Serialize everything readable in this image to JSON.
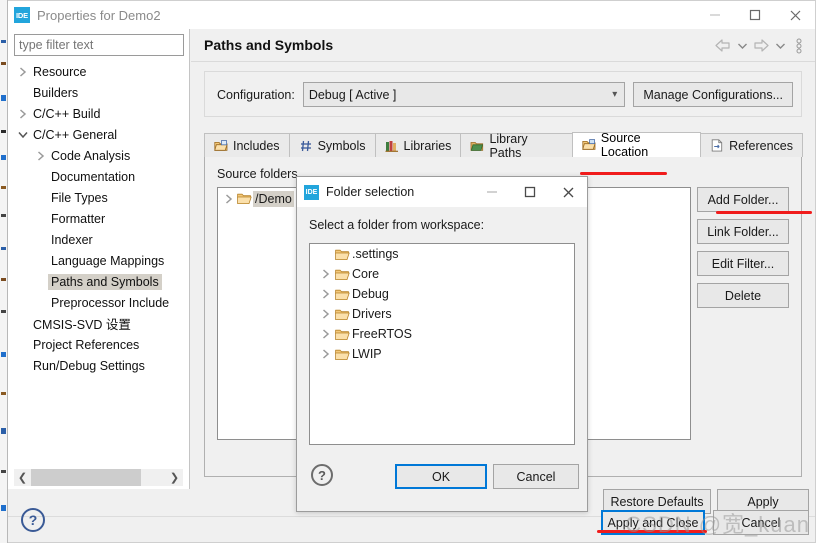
{
  "window": {
    "title": "Properties for Demo2",
    "icon": "IDE",
    "controls": {
      "minimize": "minimize-icon",
      "maximize": "maximize-icon",
      "close": "close-icon"
    }
  },
  "sidebar": {
    "filter_placeholder": "type filter text",
    "filter_value": "",
    "items": [
      {
        "label": "Resource",
        "indent": 0,
        "arrow": "collapsed",
        "selected": false
      },
      {
        "label": "Builders",
        "indent": 0,
        "arrow": "none",
        "selected": false
      },
      {
        "label": "C/C++ Build",
        "indent": 0,
        "arrow": "collapsed",
        "selected": false
      },
      {
        "label": "C/C++ General",
        "indent": 0,
        "arrow": "expanded",
        "selected": false
      },
      {
        "label": "Code Analysis",
        "indent": 1,
        "arrow": "collapsed",
        "selected": false
      },
      {
        "label": "Documentation",
        "indent": 1,
        "arrow": "none",
        "selected": false
      },
      {
        "label": "File Types",
        "indent": 1,
        "arrow": "none",
        "selected": false
      },
      {
        "label": "Formatter",
        "indent": 1,
        "arrow": "none",
        "selected": false
      },
      {
        "label": "Indexer",
        "indent": 1,
        "arrow": "none",
        "selected": false
      },
      {
        "label": "Language Mappings",
        "indent": 1,
        "arrow": "none",
        "selected": false
      },
      {
        "label": "Paths and Symbols",
        "indent": 1,
        "arrow": "none",
        "selected": true
      },
      {
        "label": "Preprocessor Include",
        "indent": 1,
        "arrow": "none",
        "selected": false
      },
      {
        "label": "CMSIS-SVD 设置",
        "indent": 0,
        "arrow": "none",
        "selected": false
      },
      {
        "label": "Project References",
        "indent": 0,
        "arrow": "none",
        "selected": false
      },
      {
        "label": "Run/Debug Settings",
        "indent": 0,
        "arrow": "none",
        "selected": false
      }
    ]
  },
  "page": {
    "title": "Paths and Symbols",
    "nav": {
      "back": "back-arrow-icon",
      "back_menu": "chevron-down-icon",
      "forward": "forward-arrow-icon",
      "forward_menu": "chevron-down-icon",
      "menu": "view-menu-icon"
    }
  },
  "configuration": {
    "label": "Configuration:",
    "value": "Debug  [ Active ]",
    "manage_label": "Manage Configurations..."
  },
  "tabs": [
    {
      "label": "Includes",
      "icon": "includes-icon",
      "active": false
    },
    {
      "label": "Symbols",
      "icon": "hash-icon",
      "active": false
    },
    {
      "label": "Libraries",
      "icon": "libraries-icon",
      "active": false
    },
    {
      "label": "Library Paths",
      "icon": "library-paths-icon",
      "active": false
    },
    {
      "label": "Source Location",
      "icon": "source-location-icon",
      "active": true
    },
    {
      "label": "References",
      "icon": "references-icon",
      "active": false
    }
  ],
  "panel": {
    "label": "Source folders",
    "rows": [
      {
        "label": "/Demo",
        "arrow": "collapsed",
        "selected": true
      }
    ],
    "buttons": [
      {
        "label": "Add Folder...",
        "annotated": true
      },
      {
        "label": "Link Folder...",
        "annotated": false
      },
      {
        "label": "Edit Filter...",
        "annotated": false
      },
      {
        "label": "Delete",
        "annotated": false
      }
    ]
  },
  "footer": {
    "restore_defaults": "Restore Defaults",
    "apply": "Apply",
    "apply_and_close": "Apply and Close",
    "cancel": "Cancel",
    "help": "?"
  },
  "dialog": {
    "icon": "IDE",
    "title": "Folder selection",
    "prompt": "Select a folder from workspace:",
    "folders": [
      {
        "label": ".settings",
        "arrow": "none"
      },
      {
        "label": "Core",
        "arrow": "collapsed"
      },
      {
        "label": "Debug",
        "arrow": "collapsed"
      },
      {
        "label": "Drivers",
        "arrow": "collapsed"
      },
      {
        "label": "FreeRTOS",
        "arrow": "collapsed"
      },
      {
        "label": "LWIP",
        "arrow": "collapsed"
      }
    ],
    "help": "?",
    "ok": "OK",
    "cancel": "Cancel",
    "controls": {
      "minimize": "minimize-icon",
      "maximize": "maximize-icon",
      "close": "close-icon"
    }
  },
  "watermark": {
    "text": "CSDN @宽_kuan"
  },
  "colors": {
    "accent": "#0078d7",
    "annotation": "#f01c1c",
    "icon_blue": "#22a5dc",
    "selection": "#d4d0c8"
  }
}
